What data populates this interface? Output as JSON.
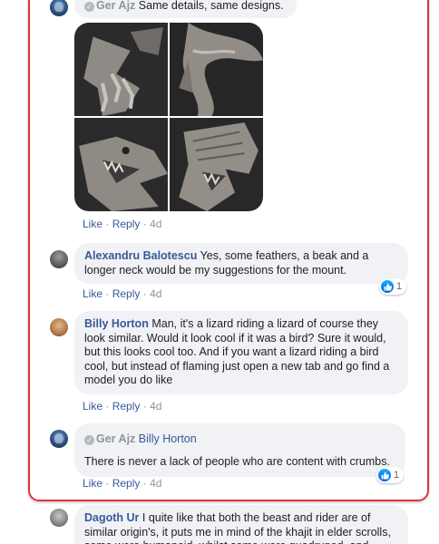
{
  "comments": [
    {
      "author": "Ger Ajz",
      "text": "Same details, same designs.",
      "actions": {
        "like": "Like",
        "reply": "Reply",
        "time": "4d"
      }
    },
    {
      "author": "Alexandru Balotescu",
      "text": "Yes, some feathers, a beak and a longer neck would be my suggestions for the mount.",
      "actions": {
        "like": "Like",
        "reply": "Reply",
        "time": "4d"
      },
      "reaction_count": "1"
    },
    {
      "author": "Billy Horton",
      "text": "Man, it's a lizard riding a lizard of course they look similar. Would it look cool if it was a bird? Sure it would, but this looks cool too. And if you want a lizard riding a bird cool, but instead of flaming just open a new tab and go find a model you do like",
      "actions": {
        "like": "Like",
        "reply": "Reply",
        "time": "4d"
      }
    },
    {
      "author": "Ger Ajz",
      "mention": "Billy Horton",
      "text": "There is never a lack of people who are content with crumbs.",
      "actions": {
        "like": "Like",
        "reply": "Reply",
        "time": "4d"
      },
      "reaction_count": "1"
    },
    {
      "author": "Dagoth Ur",
      "text": "I quite like that both the beast and rider are of similar origin's, it puts me in mind of the khajit in elder scrolls, some were humanoid, whilst some were quadruped, and"
    }
  ],
  "gallery": {
    "images": [
      "dragon-wing-claws",
      "dragon-coiled-body",
      "dragon-head-roaring",
      "dragon-head-helmet"
    ]
  },
  "icons": {
    "reaction": "like-icon",
    "badge": "check-icon"
  },
  "colors": {
    "link": "#385898",
    "highlight": "#e0353b",
    "bubble": "#f0f2f5",
    "like": "#1877f2"
  }
}
